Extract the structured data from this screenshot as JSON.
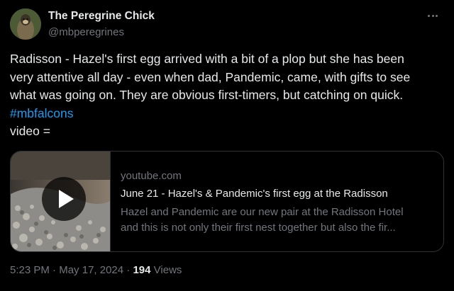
{
  "author": {
    "name": "The Peregrine Chick",
    "handle": "@mbperegrines"
  },
  "tweet": {
    "lines": [
      "Radisson - Hazel's first egg arrived with a bit of a plop but she has been",
      "very attentive all day - even when dad, Pandemic, came, with gifts to see",
      "what was going on.  They are obvious first-timers, but catching on quick."
    ],
    "hashtag": "#mbfalcons",
    "last_line": "video ="
  },
  "card": {
    "domain": "youtube.com",
    "title": "June 21 - Hazel's & Pandemic's first egg at the Radisson",
    "description_lines": [
      "Hazel and Pandemic are our new pair at the Radisson Hotel",
      "and this is not only their first nest together but also the fir..."
    ]
  },
  "meta": {
    "time": "5:23 PM",
    "separator": "·",
    "date": "May 17, 2024",
    "views_count": "194",
    "views_label": "Views"
  },
  "icons": {
    "more": "more-horizontal-icon",
    "play": "play-icon"
  },
  "colors": {
    "background": "#000000",
    "text": "#e7e9ea",
    "muted": "#71767b",
    "link": "#1d9bf0",
    "border": "#2f3336"
  }
}
